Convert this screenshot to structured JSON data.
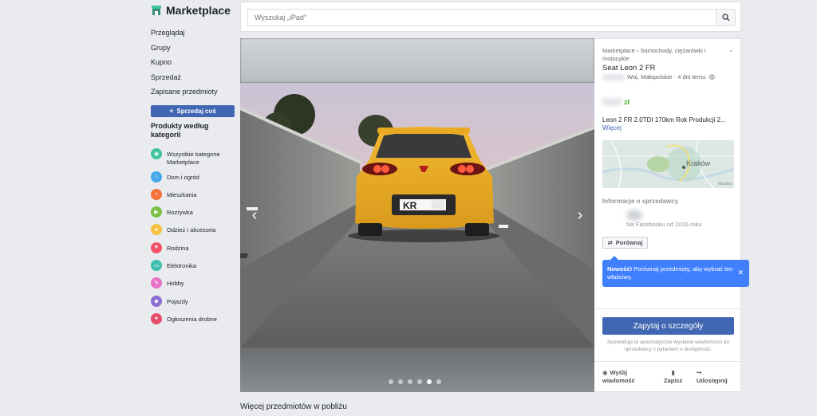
{
  "sidebar": {
    "brand": "Marketplace",
    "nav": [
      "Przeglądaj",
      "Grupy",
      "Kupno",
      "Sprzedaż",
      "Zapisane przedmioty"
    ],
    "sell_button": "Sprzedaj coś",
    "category_header": "Produkty według kategorii",
    "categories": [
      {
        "label": "Wszystkie kategorie Marketplace",
        "color": "#3ec49b",
        "icon": "all-categories-icon"
      },
      {
        "label": "Dom i ogród",
        "color": "#45a8e8",
        "icon": "home-garden-icon"
      },
      {
        "label": "Mieszkania",
        "color": "#f3713b",
        "icon": "housing-icon"
      },
      {
        "label": "Rozrywka",
        "color": "#7cc048",
        "icon": "entertainment-icon"
      },
      {
        "label": "Odzież i akcesoria",
        "color": "#f6c243",
        "icon": "clothing-icon"
      },
      {
        "label": "Rodzina",
        "color": "#f25268",
        "icon": "family-icon"
      },
      {
        "label": "Elektronika",
        "color": "#3fbfad",
        "icon": "electronics-icon"
      },
      {
        "label": "Hobby",
        "color": "#e772c6",
        "icon": "hobby-icon"
      },
      {
        "label": "Pojazdy",
        "color": "#8c6cd2",
        "icon": "vehicles-icon"
      },
      {
        "label": "Ogłoszenia drobne",
        "color": "#e64d6b",
        "icon": "classifieds-icon"
      }
    ]
  },
  "search": {
    "placeholder": "Wyszukaj „iPad”"
  },
  "listing": {
    "breadcrumb": "Marketplace › Samochody, ciężarówki i motocykle",
    "title": "Seat Leon 2 FR",
    "location": "Woj. Małopolskie · 4 dni temu · ",
    "currency": "zł",
    "description": "Leon 2 FR 2.0TDI 170km Rok Produkcji 2...",
    "more_link": "Więcej",
    "map_label": "Kraków",
    "map_credit": "Mapbox",
    "plate_text": "KR",
    "photo_count": 6,
    "active_photo": 5
  },
  "seller": {
    "heading": "Informacje o sprzedawcy",
    "since": "Na Facebooku od 2016 roku"
  },
  "compare": {
    "button": "Porównaj",
    "tooltip_bold": "Nowość!",
    "tooltip_text": " Porównaj przedmioty, aby wybrać ten właściwy."
  },
  "ask": {
    "button": "Zapytaj o szczegóły",
    "note": "Spowoduje to automatyczne wysłanie wiadomości do sprzedawcy z pytaniem o dostępność."
  },
  "actions": {
    "message": "Wyślij wiadomość",
    "save": "Zapisz",
    "share": "Udostępnij"
  },
  "more_items": "Więcej przedmiotów w pobliżu"
}
